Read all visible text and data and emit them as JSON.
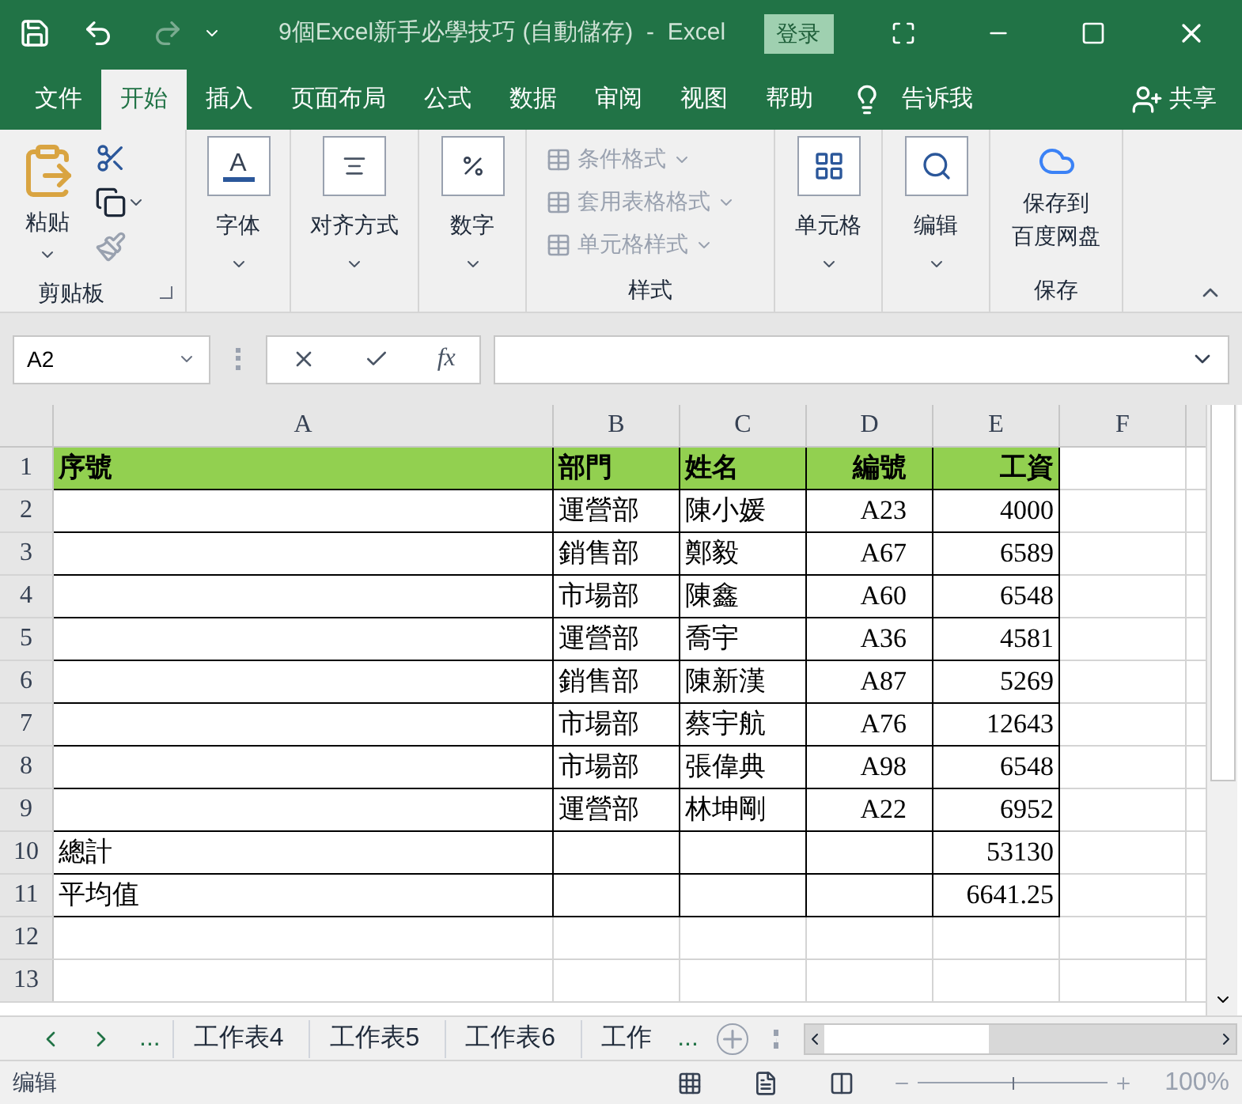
{
  "title_bar": {
    "title": "9個Excel新手必學技巧 (自動儲存)  -  Excel",
    "login": "登录"
  },
  "menu_tabs": [
    {
      "label": "文件",
      "selected": false
    },
    {
      "label": "开始",
      "selected": true
    },
    {
      "label": "插入",
      "selected": false
    },
    {
      "label": "页面布局",
      "selected": false
    },
    {
      "label": "公式",
      "selected": false
    },
    {
      "label": "数据",
      "selected": false
    },
    {
      "label": "审阅",
      "selected": false
    },
    {
      "label": "视图",
      "selected": false
    },
    {
      "label": "帮助",
      "selected": false
    }
  ],
  "tell_me": "告诉我",
  "share": "共享",
  "ribbon": {
    "clipboard": {
      "paste": "粘贴",
      "label": "剪贴板"
    },
    "font": "字体",
    "font_icon_letter": "A",
    "alignment": "对齐方式",
    "number": "数字",
    "styles": {
      "items": [
        {
          "label": "条件格式",
          "disabled": true
        },
        {
          "label": "套用表格格式",
          "disabled": true
        },
        {
          "label": "单元格样式",
          "disabled": true
        }
      ],
      "label": "样式"
    },
    "cells": "单元格",
    "editing": "编辑",
    "save": {
      "button_lines": [
        "保存到",
        "百度网盘"
      ],
      "label": "保存"
    }
  },
  "name_box": "A2",
  "formula_bar": {
    "fx": "fx"
  },
  "columns": [
    "A",
    "B",
    "C",
    "D",
    "E",
    "F"
  ],
  "rows": [
    {
      "header": "1",
      "highlighted": true,
      "bordered": true,
      "cells": [
        "序號",
        "部門",
        "姓名",
        "編號",
        "工資",
        ""
      ]
    },
    {
      "header": "2",
      "highlighted": false,
      "bordered": true,
      "cells": [
        "",
        "運營部",
        "陳小媛",
        "A23",
        "4000",
        ""
      ]
    },
    {
      "header": "3",
      "highlighted": false,
      "bordered": true,
      "cells": [
        "",
        "銷售部",
        "鄭毅",
        "A67",
        "6589",
        ""
      ]
    },
    {
      "header": "4",
      "highlighted": false,
      "bordered": true,
      "cells": [
        "",
        "市場部",
        "陳鑫",
        "A60",
        "6548",
        ""
      ]
    },
    {
      "header": "5",
      "highlighted": false,
      "bordered": true,
      "cells": [
        "",
        "運營部",
        "喬宇",
        "A36",
        "4581",
        ""
      ]
    },
    {
      "header": "6",
      "highlighted": false,
      "bordered": true,
      "cells": [
        "",
        "銷售部",
        "陳新漢",
        "A87",
        "5269",
        ""
      ]
    },
    {
      "header": "7",
      "highlighted": false,
      "bordered": true,
      "cells": [
        "",
        "市場部",
        "蔡宇航",
        "A76",
        "12643",
        ""
      ]
    },
    {
      "header": "8",
      "highlighted": false,
      "bordered": true,
      "cells": [
        "",
        "市場部",
        "張偉典",
        "A98",
        "6548",
        ""
      ]
    },
    {
      "header": "9",
      "highlighted": false,
      "bordered": true,
      "cells": [
        "",
        "運營部",
        "林坤剛",
        "A22",
        "6952",
        ""
      ]
    },
    {
      "header": "10",
      "highlighted": false,
      "bordered": true,
      "cells": [
        "總計",
        "",
        "",
        "",
        "53130",
        ""
      ]
    },
    {
      "header": "11",
      "highlighted": false,
      "bordered": true,
      "cells": [
        "平均值",
        "",
        "",
        "",
        "6641.25",
        ""
      ]
    },
    {
      "header": "12",
      "highlighted": false,
      "bordered": false,
      "cells": [
        "",
        "",
        "",
        "",
        "",
        ""
      ]
    },
    {
      "header": "13",
      "highlighted": false,
      "bordered": false,
      "cells": [
        "",
        "",
        "",
        "",
        "",
        ""
      ]
    }
  ],
  "sheet_nav": {
    "more": "..."
  },
  "sheet_tabs": [
    {
      "label": "工作表4",
      "selected": false
    },
    {
      "label": "工作表5",
      "selected": false
    },
    {
      "label": "工作表6",
      "selected": false
    },
    {
      "label": "工作",
      "selected": false
    }
  ],
  "sheet_more": "...",
  "status_bar": {
    "mode": "编辑",
    "zoom": "100%",
    "zoom_slider": {
      "level": 0.5
    }
  }
}
